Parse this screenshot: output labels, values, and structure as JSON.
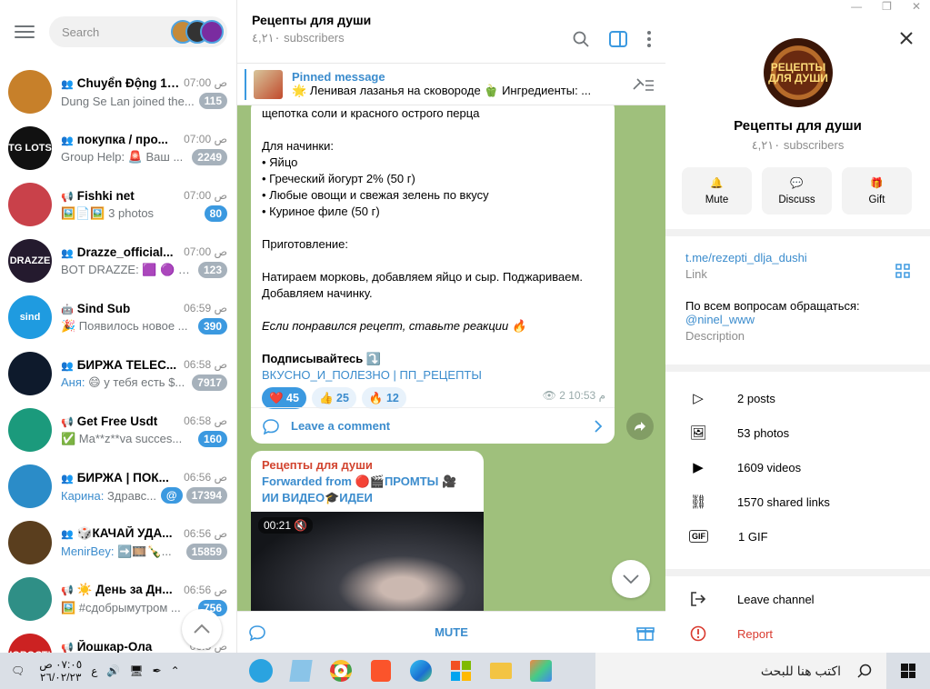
{
  "window": {
    "min": "—",
    "restore": "❐",
    "close": "✕"
  },
  "left": {
    "search_placeholder": "Search",
    "chats": [
      {
        "name": "Chuyển Động 12h",
        "time": "07:00 ص",
        "msg_sender": "",
        "msg": "Dung Se Lan joined the...",
        "badge": "115",
        "badge_blue": false,
        "color": "#c7802a",
        "kind": "group"
      },
      {
        "name": "покупка / про...",
        "time": "07:00 ص",
        "msg_sender": "",
        "msg": "Group Help: 🚨 Ваш ...",
        "badge": "2249",
        "badge_blue": false,
        "color": "#111111",
        "kind": "group",
        "av_text": "TG LOTS"
      },
      {
        "name": "Fishki net",
        "time": "07:00 ص",
        "msg_sender": "",
        "msg": "🖼️📄🖼️ 3 photos",
        "badge": "80",
        "badge_blue": true,
        "color": "#c9414a",
        "kind": "channel"
      },
      {
        "name": "Drazze_official...",
        "time": "07:00 ص",
        "msg_sender": "",
        "msg": "BOT DRAZZE: 🟪 🟣 П...",
        "badge": "123",
        "badge_blue": false,
        "color": "#241a2e",
        "kind": "group",
        "av_text": "DRAZZE"
      },
      {
        "name": "Sind Sub",
        "time": "06:59 ص",
        "msg_sender": "",
        "msg": "🎉 Появилось новое ...",
        "badge": "390",
        "badge_blue": true,
        "color": "#1f9be0",
        "kind": "bot",
        "av_text": "sind"
      },
      {
        "name": "БИРЖА TELEC...",
        "time": "06:58 ص",
        "msg_sender": "Аня:",
        "msg": "😄 у тебя есть $...",
        "badge": "7917",
        "badge_blue": false,
        "color": "#0e1a2c",
        "kind": "group"
      },
      {
        "name": "Get Free Usdt",
        "time": "06:58 ص",
        "msg_sender": "",
        "msg": "✅ Ma**z**va succes...",
        "badge": "160",
        "badge_blue": true,
        "color": "#1b9a7c",
        "kind": "channel"
      },
      {
        "name": "БИРЖА | ПОК...",
        "time": "06:56 ص",
        "msg_sender": "Карина:",
        "msg": "Здравс...",
        "badge": "17394",
        "badge_blue": false,
        "color": "#2b8cc8",
        "kind": "group",
        "at": true
      },
      {
        "name": "🎲КАЧАЙ УДА...",
        "time": "06:56 ص",
        "msg_sender": "MenirBey:",
        "msg": "➡️🎞️🍾...",
        "badge": "15859",
        "badge_blue": false,
        "color": "#5a3e1e",
        "kind": "group"
      },
      {
        "name": "☀️ День за Дн...",
        "time": "06:56 ص",
        "msg_sender": "",
        "msg": "🖼️ #сдобрымутром ...",
        "badge": "756",
        "badge_blue": true,
        "color": "#2f8f86",
        "kind": "channel"
      },
      {
        "name": "Йошкар-Ола",
        "time": "06:5 ص",
        "msg_sender": "",
        "msg": "",
        "badge": "",
        "badge_blue": false,
        "color": "#c22",
        "kind": "channel",
        "av_text": "НОВОСТИ"
      }
    ]
  },
  "mid": {
    "title": "Рецепты для души",
    "subscribers": "٤,٢١٠ subscribers",
    "pinned_title": "Pinned message",
    "pinned_text": "🌟 Ленивая лазанья на сковороде 🫑 Ингредиенты: ...",
    "msg1_lines": [
      "щепотка соли и красного острого перца",
      "",
      "Для начинки:",
      "• Яйцо",
      "• Греческий йогурт 2% (50 г)",
      "• Любые овощи и свежая зелень по вкусу",
      "• Куриное филе (50 г)",
      "",
      "Приготовление:",
      "",
      "Натираем морковь, добавляем яйцо и сыр. Поджариваем.",
      "Добавляем начинку.",
      ""
    ],
    "msg1_italic": "Если понравился рецепт, ставьте реакции 🔥",
    "msg1_subscribe": "Подписывайтесь ⤵️",
    "msg1_links": "ВКУСНО_И_ПОЛЕЗНО | ПП_РЕЦЕПТЫ",
    "reactions": [
      {
        "label": "❤️ 45",
        "selected": true
      },
      {
        "label": "👍 25",
        "selected": false
      },
      {
        "label": "🔥 12",
        "selected": false
      }
    ],
    "msg1_meta": "👁 2  م 10:53",
    "comment": "Leave a comment",
    "msg2_from": "Рецепты для души",
    "msg2_fwd": "Forwarded from 🔴🎬ПРОМТЫ 🎥 ИИ ВИДЕО🎓ИДЕИ",
    "video_duration": "00:21 🔇",
    "footer": "MUTE"
  },
  "right": {
    "logo_text": "РЕЦЕПТЫ ДЛЯ ДУШИ",
    "name": "Рецепты для души",
    "subscribers": "٤,٢١٠ subscribers",
    "buttons": [
      {
        "label": "Mute",
        "icon": "🔔"
      },
      {
        "label": "Discuss",
        "icon": "💬"
      },
      {
        "label": "Gift",
        "icon": "🎁"
      }
    ],
    "link": "t.me/rezepti_dlja_dushi",
    "link_label": "Link",
    "description": "По всем вопросам обращаться:",
    "desc_handle": "@ninel_www",
    "desc_label": "Description",
    "media": [
      {
        "label": "2 posts",
        "icon": "▷"
      },
      {
        "label": "53 photos",
        "icon": "🖼"
      },
      {
        "label": "1609 videos",
        "icon": "▶"
      },
      {
        "label": "1570 shared links",
        "icon": "⛓"
      },
      {
        "label": "1 GIF",
        "icon": "GIF"
      }
    ],
    "leave": "Leave channel",
    "report": "Report"
  },
  "taskbar": {
    "clock_time": "٠٧:٠٥ ص",
    "clock_date": "٢٦/٠٢/٢٣",
    "lang": "ع",
    "search_text": "اكتب هنا للبحث"
  }
}
